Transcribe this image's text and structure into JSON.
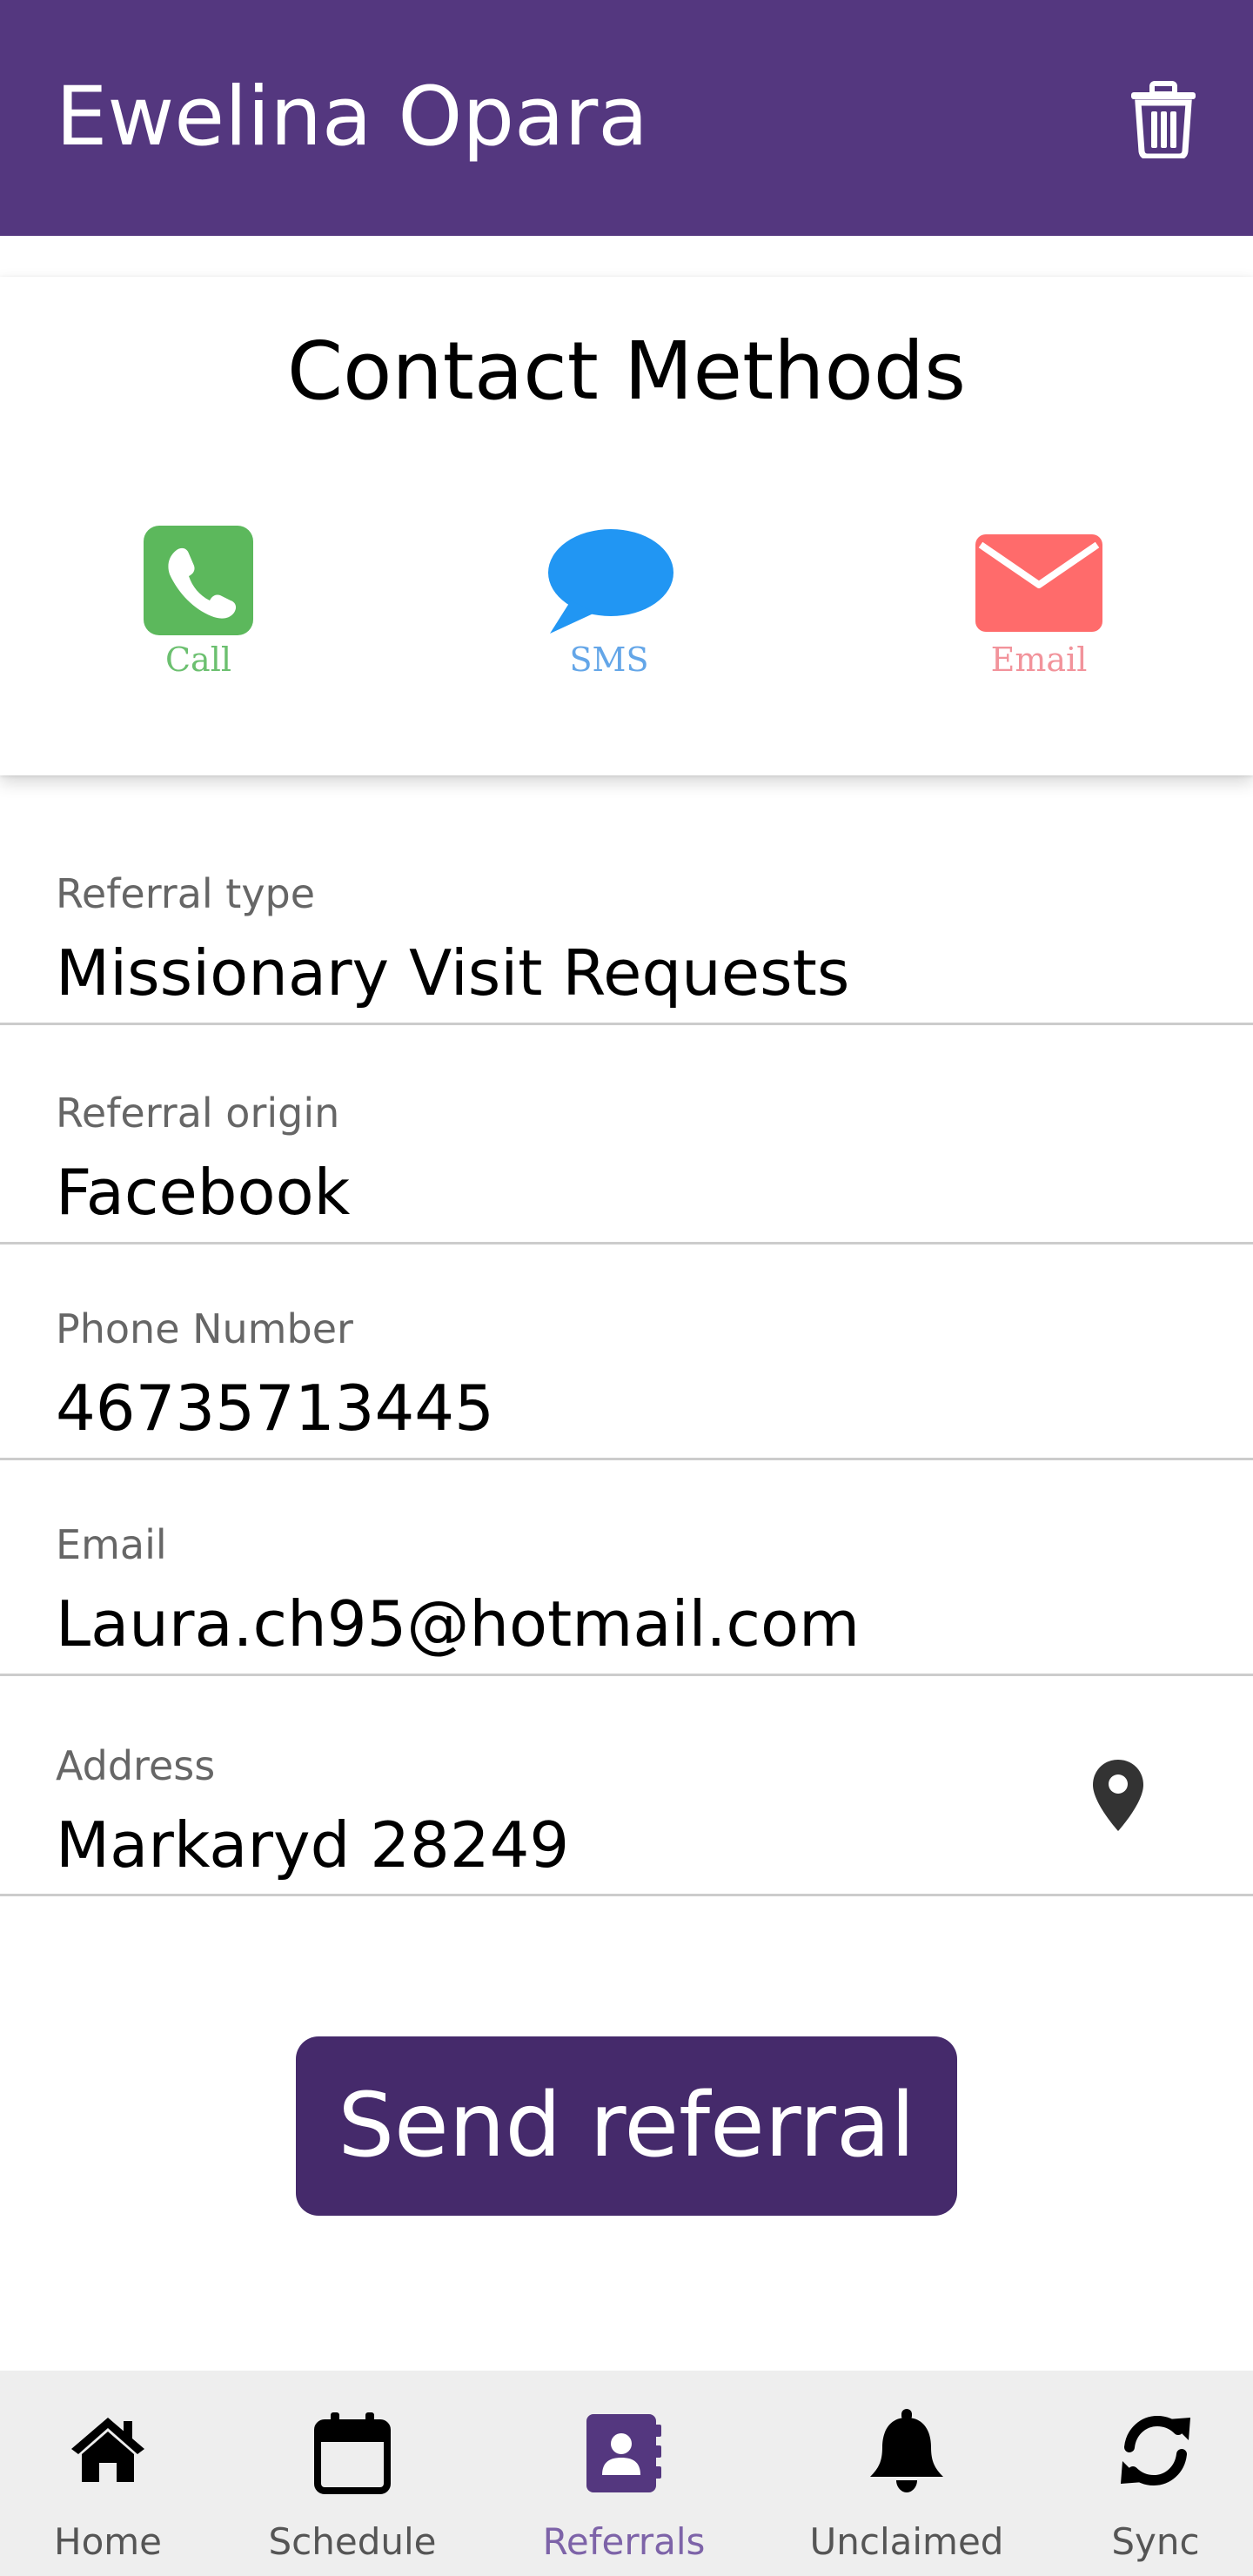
{
  "header": {
    "title": "Ewelina Opara",
    "delete_icon": "trash-icon"
  },
  "contact_methods": {
    "heading": "Contact Methods",
    "methods": [
      {
        "label": "Call",
        "icon": "phone-icon",
        "color": "#5cb85c"
      },
      {
        "label": "SMS",
        "icon": "chat-bubble-icon",
        "color": "#2196f3"
      },
      {
        "label": "Email",
        "icon": "envelope-icon",
        "color": "#ff6b6b"
      }
    ]
  },
  "fields": {
    "referral_type": {
      "label": "Referral type",
      "value": "Missionary Visit Requests"
    },
    "referral_origin": {
      "label": "Referral origin",
      "value": "Facebook"
    },
    "phone": {
      "label": "Phone Number",
      "value": "46735713445"
    },
    "email": {
      "label": "Email",
      "value": "Laura.ch95@hotmail.com"
    },
    "address": {
      "label": "Address",
      "value": "Markaryd 28249",
      "icon": "map-pin-icon"
    }
  },
  "send_button": {
    "label": "Send referral"
  },
  "tabbar": {
    "active": "Referrals",
    "accent": "#54377f",
    "tabs": [
      {
        "label": "Home",
        "icon": "home-icon"
      },
      {
        "label": "Schedule",
        "icon": "calendar-icon"
      },
      {
        "label": "Referrals",
        "icon": "contact-book-icon"
      },
      {
        "label": "Unclaimed",
        "icon": "bell-icon"
      },
      {
        "label": "Sync",
        "icon": "sync-icon"
      }
    ]
  }
}
